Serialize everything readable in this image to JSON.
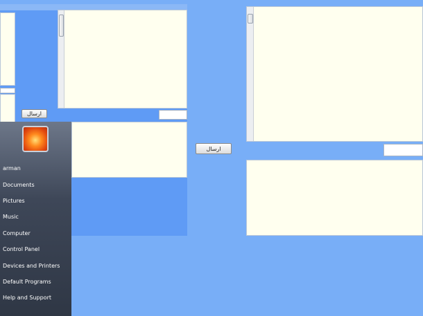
{
  "back_window": {
    "send_label": "ارسال"
  },
  "start_menu": {
    "items": [
      {
        "label": "arman"
      },
      {
        "label": "Documents"
      },
      {
        "label": "Pictures"
      },
      {
        "label": "Music"
      },
      {
        "label": "Computer"
      },
      {
        "label": "Control Panel"
      },
      {
        "label": "Devices and Printers"
      },
      {
        "label": "Default Programs"
      },
      {
        "label": "Help and Support"
      }
    ],
    "avatar_icon": "user-picture-flower-icon"
  },
  "main_window": {
    "send_label": "ارسال"
  },
  "colors": {
    "desktop_background": "#78aef7",
    "pane_background": "#ffffef",
    "start_menu_top": "#6d7789",
    "start_menu_bottom": "#2f3745"
  }
}
